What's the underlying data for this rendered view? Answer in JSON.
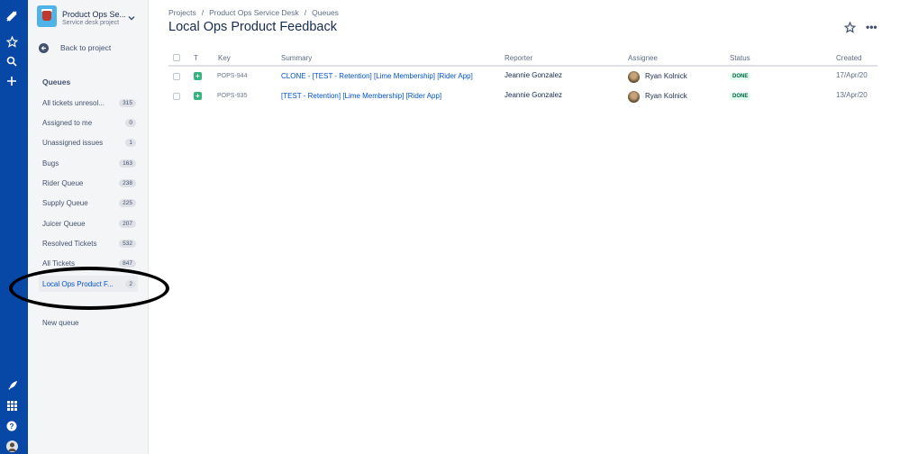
{
  "sidebar": {
    "project_name": "Product Ops Se...",
    "project_type": "Service desk project",
    "back_label": "Back to project",
    "queues_heading": "Queues",
    "queues": [
      {
        "label": "All tickets unresol...",
        "count": "315"
      },
      {
        "label": "Assigned to me",
        "count": "0"
      },
      {
        "label": "Unassigned issues",
        "count": "1"
      },
      {
        "label": "Bugs",
        "count": "163"
      },
      {
        "label": "Rider Queue",
        "count": "238"
      },
      {
        "label": "Supply Queue",
        "count": "225"
      },
      {
        "label": "Juicer Queue",
        "count": "207"
      },
      {
        "label": "Resolved Tickets",
        "count": "532"
      },
      {
        "label": "All Tickets",
        "count": "847"
      },
      {
        "label": "Local Ops Product F...",
        "count": "2"
      }
    ],
    "new_queue_label": "New queue"
  },
  "breadcrumbs": [
    "Projects",
    "Product Ops Service Desk",
    "Queues"
  ],
  "page_title": "Local Ops Product Feedback",
  "table": {
    "headers": {
      "t": "T",
      "key": "Key",
      "summary": "Summary",
      "reporter": "Reporter",
      "assignee": "Assignee",
      "status": "Status",
      "created": "Created"
    },
    "rows": [
      {
        "key": "POPS-944",
        "summary": "CLONE - [TEST - Retention] [Lime Membership] [Rider App]",
        "reporter": "Jeannie Gonzalez",
        "assignee": "Ryan Kolnick",
        "status": "DONE",
        "created": "17/Apr/20"
      },
      {
        "key": "POPS-935",
        "summary": "[TEST - Retention] [Lime Membership] [Rider App]",
        "reporter": "Jeannie Gonzalez",
        "assignee": "Ryan Kolnick",
        "status": "DONE",
        "created": "13/Apr/20"
      }
    ]
  },
  "icons": [
    "jira-logo-icon",
    "star-icon",
    "search-icon",
    "plus-icon",
    "rocket-icon",
    "app-switcher-icon",
    "help-icon",
    "user-avatar-icon",
    "chevron-down-icon",
    "back-arrow-icon",
    "more-icon",
    "story-type-icon"
  ],
  "colors": {
    "nav": "#0747a6",
    "link": "#0052cc",
    "done": "#006644",
    "done_bg": "#e3fcef"
  }
}
